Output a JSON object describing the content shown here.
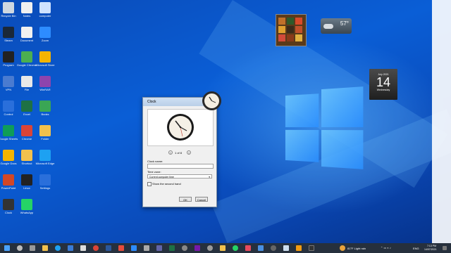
{
  "desktop_icons": [
    {
      "label": "Recycle Bin",
      "icon": "recycle-bin-icon",
      "color": "#d0d8e0"
    },
    {
      "label": "Notes",
      "icon": "file-icon",
      "color": "#f0f0f0"
    },
    {
      "label": "computer",
      "icon": "computer-icon",
      "color": "#cfe2ff"
    },
    {
      "label": "Steam",
      "icon": "steam-icon",
      "color": "#1b2838"
    },
    {
      "label": "Document",
      "icon": "file-icon",
      "color": "#f0f0f0"
    },
    {
      "label": "Zoom",
      "icon": "zoom-icon",
      "color": "#2d8cff"
    },
    {
      "label": "Program",
      "icon": "app-icon",
      "color": "#222222"
    },
    {
      "label": "Google Chrome",
      "icon": "chrome-icon",
      "color": "#4caf50"
    },
    {
      "label": "Microsoft Store",
      "icon": "store-icon",
      "color": "#f4b400"
    },
    {
      "label": "VPN",
      "icon": "vpn-icon",
      "color": "#4a7bd0"
    },
    {
      "label": "File",
      "icon": "file-icon",
      "color": "#e8e8e8"
    },
    {
      "label": "WinRAR",
      "icon": "archive-icon",
      "color": "#8e44ad"
    },
    {
      "label": "Control",
      "icon": "settings-icon",
      "color": "#2a6fdb"
    },
    {
      "label": "Excel",
      "icon": "excel-icon",
      "color": "#1e7145"
    },
    {
      "label": "Books",
      "icon": "books-icon",
      "color": "#3aa655"
    },
    {
      "label": "Google Sheets",
      "icon": "sheets-icon",
      "color": "#0f9d58"
    },
    {
      "label": "Chrome",
      "icon": "chrome-icon",
      "color": "#db4437"
    },
    {
      "label": "Folder",
      "icon": "folder-icon",
      "color": "#f2c14e"
    },
    {
      "label": "Google Docs",
      "icon": "docs-icon",
      "color": "#f4b400"
    },
    {
      "label": "Shortcut",
      "icon": "shortcut-icon",
      "color": "#f2c14e"
    },
    {
      "label": "Microsoft Edge",
      "icon": "edge-icon",
      "color": "#1da1f2"
    },
    {
      "label": "PowerPoint",
      "icon": "powerpoint-icon",
      "color": "#d24726"
    },
    {
      "label": "Linux",
      "icon": "linux-icon",
      "color": "#222222"
    },
    {
      "label": "Settings",
      "icon": "settings-icon",
      "color": "#2a6fdb"
    },
    {
      "label": "Clock",
      "icon": "clock-icon",
      "color": "#333333"
    },
    {
      "label": "WhatsApp",
      "icon": "whatsapp-icon",
      "color": "#25d366"
    }
  ],
  "gadgets": {
    "weather_temp": "57°",
    "calendar_month": "July 2021",
    "calendar_day": "14",
    "calendar_weekday": "Wednesday"
  },
  "dialog": {
    "title": "Clock",
    "pager": "1 of 8",
    "clock_name_label": "Clock name:",
    "clock_name_value": "",
    "timezone_label": "Time zone:",
    "timezone_value": "Current computer time",
    "second_hand_label": "Show the second hand",
    "ok_label": "OK",
    "cancel_label": "Cancel"
  },
  "taskbar": {
    "weather": "81°F  Light rain",
    "lang": "ENG",
    "time": "7:13 PM",
    "date": "14/07/2021"
  }
}
